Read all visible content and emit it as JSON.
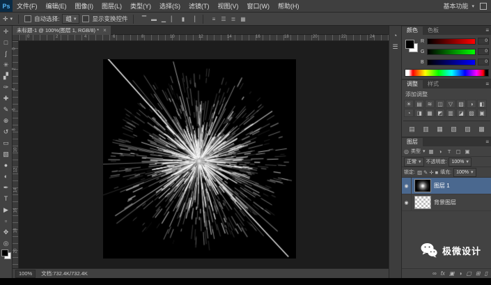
{
  "app": {
    "logo": "Ps",
    "workspace": "基本功能"
  },
  "menubar": {
    "items": [
      "文件(F)",
      "编辑(E)",
      "图像(I)",
      "图层(L)",
      "类型(Y)",
      "选择(S)",
      "滤镜(T)",
      "视图(V)",
      "窗口(W)",
      "帮助(H)"
    ]
  },
  "options": {
    "auto_select_label": "自动选择:",
    "auto_select_value": "组",
    "show_transform_label": "显示变换控件",
    "align_icons": [
      {
        "name": "align-top-edges-icon",
        "glyph": "▔"
      },
      {
        "name": "align-vertical-centers-icon",
        "glyph": "▬"
      },
      {
        "name": "align-bottom-edges-icon",
        "glyph": "▁"
      },
      {
        "name": "align-left-edges-icon",
        "glyph": "▏"
      },
      {
        "name": "align-horizontal-centers-icon",
        "glyph": "▮"
      },
      {
        "name": "align-right-edges-icon",
        "glyph": "▕"
      }
    ],
    "distribute_icons": [
      {
        "name": "distribute-top-edges-icon",
        "glyph": "≡"
      },
      {
        "name": "distribute-vertical-centers-icon",
        "glyph": "☰"
      },
      {
        "name": "distribute-bottom-edges-icon",
        "glyph": "≣"
      },
      {
        "name": "auto-align-layers-icon",
        "glyph": "▦"
      }
    ]
  },
  "document": {
    "tab_title": "未标题-1 @ 100%(图层 1, RGB/8) *",
    "zoom": "100%",
    "doc_info": "文档:732.4K/732.4K"
  },
  "rulers": {
    "horizontal": [
      "0",
      "2",
      "4",
      "6",
      "8",
      "10",
      "12",
      "14",
      "16",
      "18",
      "20",
      "22",
      "24"
    ],
    "vertical": [
      "0",
      "2",
      "4",
      "6",
      "8",
      "10",
      "12",
      "14",
      "16",
      "18",
      "20"
    ]
  },
  "tools": [
    {
      "name": "move-tool",
      "glyph": "✛"
    },
    {
      "name": "rectangular-marquee-tool",
      "glyph": "□"
    },
    {
      "name": "lasso-tool",
      "glyph": "ʃ"
    },
    {
      "name": "quick-selection-tool",
      "glyph": "✳"
    },
    {
      "name": "crop-tool",
      "glyph": "▞"
    },
    {
      "name": "eyedropper-tool",
      "glyph": "✑"
    },
    {
      "name": "healing-brush-tool",
      "glyph": "✚"
    },
    {
      "name": "brush-tool",
      "glyph": "✎"
    },
    {
      "name": "clone-stamp-tool",
      "glyph": "⊕"
    },
    {
      "name": "history-brush-tool",
      "glyph": "↺"
    },
    {
      "name": "eraser-tool",
      "glyph": "▭"
    },
    {
      "name": "gradient-tool",
      "glyph": "▧"
    },
    {
      "name": "blur-tool",
      "glyph": "●"
    },
    {
      "name": "dodge-tool",
      "glyph": "◐"
    },
    {
      "name": "pen-tool",
      "glyph": "✒"
    },
    {
      "name": "type-tool",
      "glyph": "T"
    },
    {
      "name": "path-selection-tool",
      "glyph": "▶"
    },
    {
      "name": "rectangle-tool",
      "glyph": "▫"
    },
    {
      "name": "hand-tool",
      "glyph": "✥"
    },
    {
      "name": "zoom-tool",
      "glyph": "◎"
    }
  ],
  "right_strip": [
    {
      "name": "history-panel-icon",
      "glyph": "◔"
    },
    {
      "name": "properties-panel-icon",
      "glyph": "☰"
    }
  ],
  "color_panel": {
    "tabs": [
      "颜色",
      "色板"
    ],
    "channels": [
      {
        "label": "R",
        "value": "0"
      },
      {
        "label": "G",
        "value": "0"
      },
      {
        "label": "B",
        "value": "0"
      }
    ]
  },
  "adjustments_panel": {
    "tabs": [
      "调整",
      "样式"
    ],
    "add_label": "添加调整",
    "icons_row1": [
      {
        "name": "brightness-contrast-icon",
        "glyph": "☀"
      },
      {
        "name": "levels-icon",
        "glyph": "▤"
      },
      {
        "name": "curves-icon",
        "glyph": "≋"
      },
      {
        "name": "exposure-icon",
        "glyph": "◫"
      },
      {
        "name": "vibrance-icon",
        "glyph": "▽"
      },
      {
        "name": "hue-saturation-icon",
        "glyph": "▧"
      },
      {
        "name": "color-balance-icon",
        "glyph": "◑"
      },
      {
        "name": "black-white-icon",
        "glyph": "◧"
      }
    ],
    "icons_row2": [
      {
        "name": "photo-filter-icon",
        "glyph": "◔"
      },
      {
        "name": "channel-mixer-icon",
        "glyph": "◨"
      },
      {
        "name": "color-lookup-icon",
        "glyph": "▦"
      },
      {
        "name": "invert-icon",
        "glyph": "◩"
      },
      {
        "name": "posterize-icon",
        "glyph": "▥"
      },
      {
        "name": "threshold-icon",
        "glyph": "◪"
      },
      {
        "name": "gradient-map-icon",
        "glyph": "▨"
      },
      {
        "name": "selective-color-icon",
        "glyph": "▣"
      }
    ],
    "strip_icons": [
      {
        "name": "docked-panel-icon-1",
        "glyph": "▤"
      },
      {
        "name": "docked-panel-icon-2",
        "glyph": "▥"
      },
      {
        "name": "docked-panel-icon-3",
        "glyph": "▦"
      },
      {
        "name": "docked-panel-icon-4",
        "glyph": "▧"
      },
      {
        "name": "docked-panel-icon-5",
        "glyph": "▨"
      },
      {
        "name": "docked-panel-icon-6",
        "glyph": "▩"
      }
    ]
  },
  "layers_panel": {
    "tab": "图层",
    "filter_label": "类型",
    "filter_icons": [
      {
        "name": "filter-pixel-layers-icon",
        "glyph": "▦"
      },
      {
        "name": "filter-adjustment-layers-icon",
        "glyph": "◑"
      },
      {
        "name": "filter-type-layers-icon",
        "glyph": "T"
      },
      {
        "name": "filter-shape-layers-icon",
        "glyph": "▢"
      },
      {
        "name": "filter-smart-objects-icon",
        "glyph": "▣"
      }
    ],
    "blend_mode": "正常",
    "opacity_label": "不透明度:",
    "opacity": "100%",
    "lock_label": "锁定:",
    "lock_icons": [
      {
        "name": "lock-transparency-icon",
        "glyph": "▨"
      },
      {
        "name": "lock-pixels-icon",
        "glyph": "✎"
      },
      {
        "name": "lock-position-icon",
        "glyph": "✛"
      },
      {
        "name": "lock-all-icon",
        "glyph": "■"
      }
    ],
    "fill_label": "填充:",
    "fill": "100%",
    "layers": [
      {
        "name": "图层 1",
        "selected": true,
        "thumb": "starburst"
      },
      {
        "name": "背景图层",
        "selected": false,
        "thumb": "checker"
      }
    ],
    "bottom_icons": [
      {
        "name": "link-layers-icon",
        "glyph": "∞"
      },
      {
        "name": "layer-style-icon",
        "glyph": "fx"
      },
      {
        "name": "add-layer-mask-icon",
        "glyph": "▣"
      },
      {
        "name": "new-adjustment-layer-icon",
        "glyph": "◑"
      },
      {
        "name": "new-group-icon",
        "glyph": "▢"
      },
      {
        "name": "new-layer-icon",
        "glyph": "⊞"
      },
      {
        "name": "delete-layer-icon",
        "glyph": "▯"
      }
    ]
  },
  "icons": {
    "eye": "◉",
    "move_tool": "✛",
    "filter": "◎",
    "panel_menu": "≡"
  },
  "watermark": {
    "text": "极微设计"
  },
  "colors": {
    "layer_selection": "#4a688f",
    "logo_blue": "#54b4f5"
  }
}
